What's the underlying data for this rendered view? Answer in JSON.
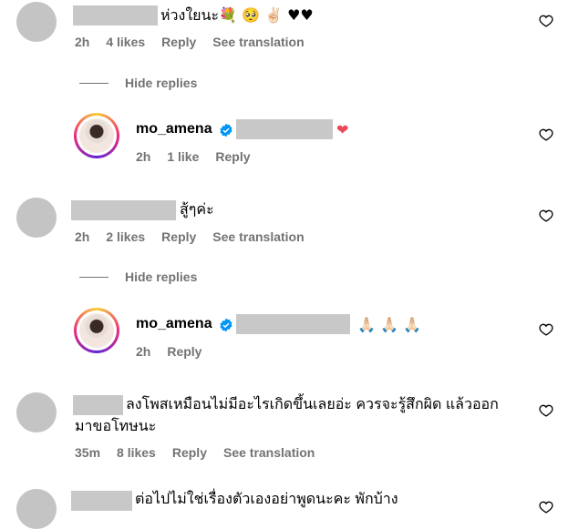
{
  "comments": [
    {
      "text": "ห่วงใยนะ💐 🥺 ✌🏻 ♥♥",
      "time": "2h",
      "likes": "4 likes",
      "reply": "Reply",
      "translate": "See translation",
      "hide_replies": "Hide replies",
      "reply_item": {
        "username": "mo_amena",
        "text": "❤",
        "time": "2h",
        "likes": "1 like",
        "reply": "Reply"
      }
    },
    {
      "text": "สู้ๆค่ะ",
      "time": "2h",
      "likes": "2 likes",
      "reply": "Reply",
      "translate": "See translation",
      "hide_replies": "Hide replies",
      "reply_item": {
        "username": "mo_amena",
        "text": "🙏🏻 🙏🏻 🙏🏻",
        "time": "2h",
        "reply": "Reply"
      }
    },
    {
      "text_line1": "ลงโพสเหมือนไม่มีอะไรเกิดขึ้นเลยอ่ะ ควรจะรู้สึกผิด แล้วออก",
      "text_line2": "มาขอโทษนะ",
      "time": "35m",
      "likes": "8 likes",
      "reply": "Reply",
      "translate": "See translation"
    },
    {
      "text": "ต่อไปไม่ใช่เรื่องตัวเองอย่าพูดนะคะ พักบ้าง"
    }
  ],
  "colors": {
    "meta": "#737373",
    "verified": "#0095f6",
    "heart_red": "#ed4956"
  },
  "icons": [
    "heart-icon",
    "verified-badge-icon"
  ]
}
